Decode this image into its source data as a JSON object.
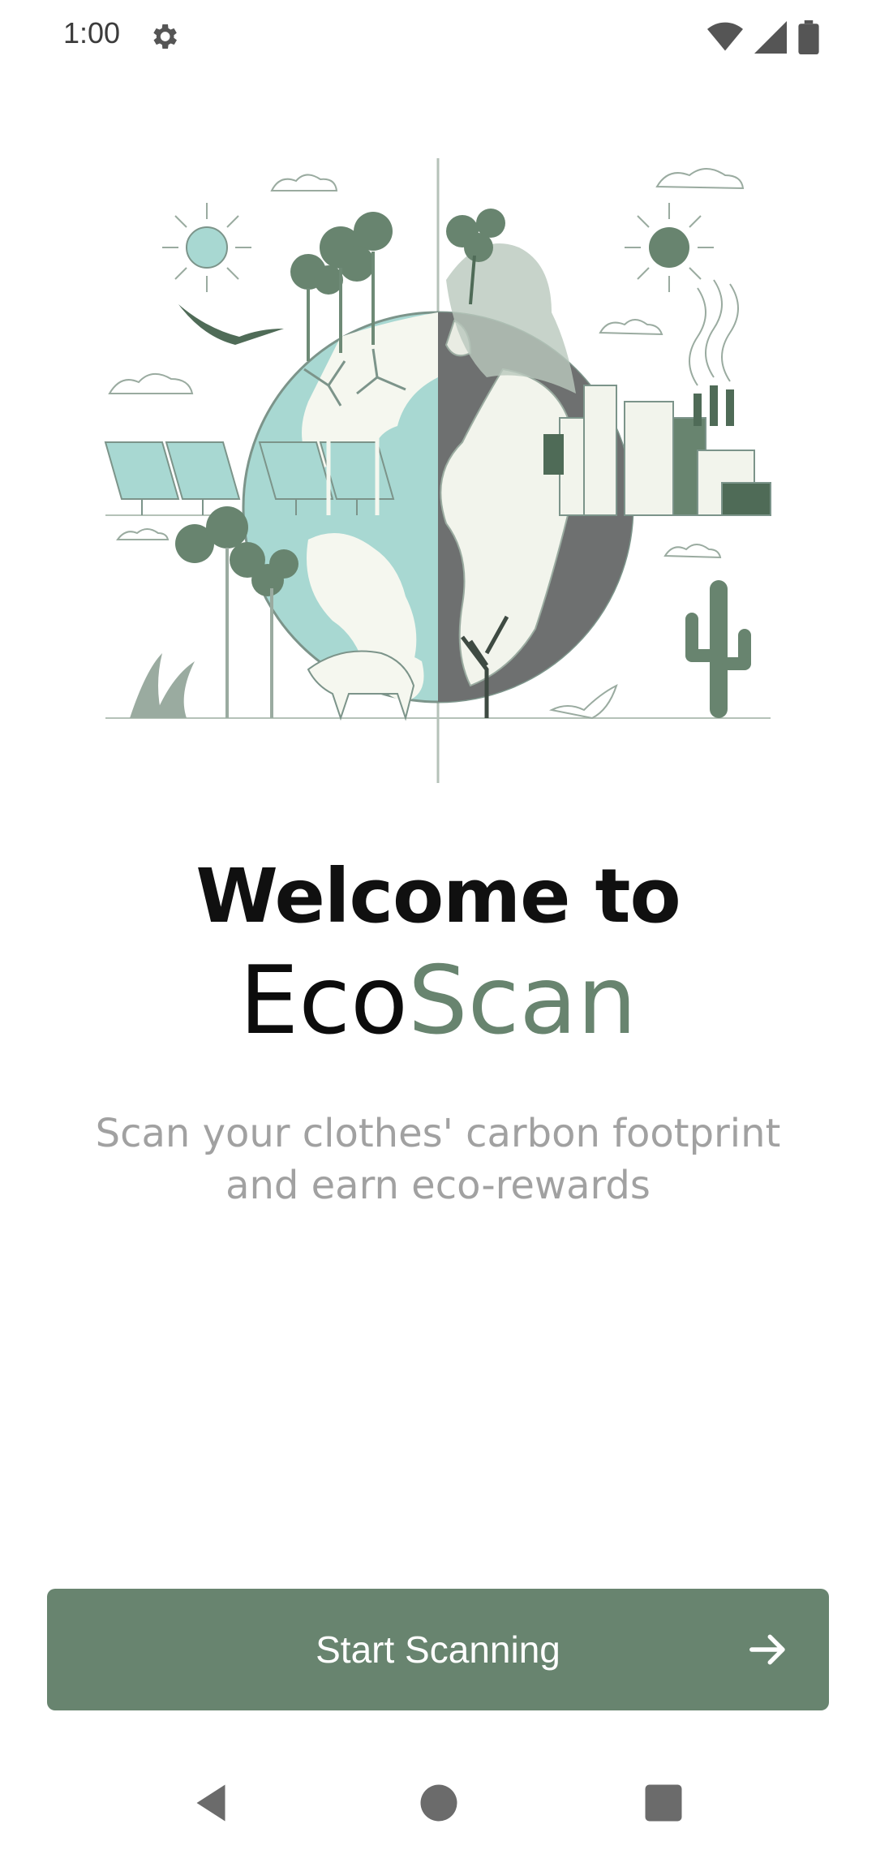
{
  "status_bar": {
    "time": "1:00",
    "icons": [
      "settings-gear-icon",
      "wifi-icon",
      "cellular-signal-icon",
      "battery-icon"
    ]
  },
  "hero": {
    "icon": "earth-environment-illustration"
  },
  "welcome": {
    "line1": "Welcome to",
    "brand_prefix": "Eco",
    "brand_accent": "Scan"
  },
  "subtitle": "Scan your clothes' carbon footprint and earn eco-rewards",
  "cta": {
    "label": "Start Scanning",
    "icon": "arrow-right-icon"
  },
  "nav": {
    "icons": [
      "back-icon",
      "home-icon",
      "recents-icon"
    ]
  },
  "colors": {
    "accent": "#68846f",
    "subtitle": "#a1a1a1",
    "title": "#101010"
  }
}
